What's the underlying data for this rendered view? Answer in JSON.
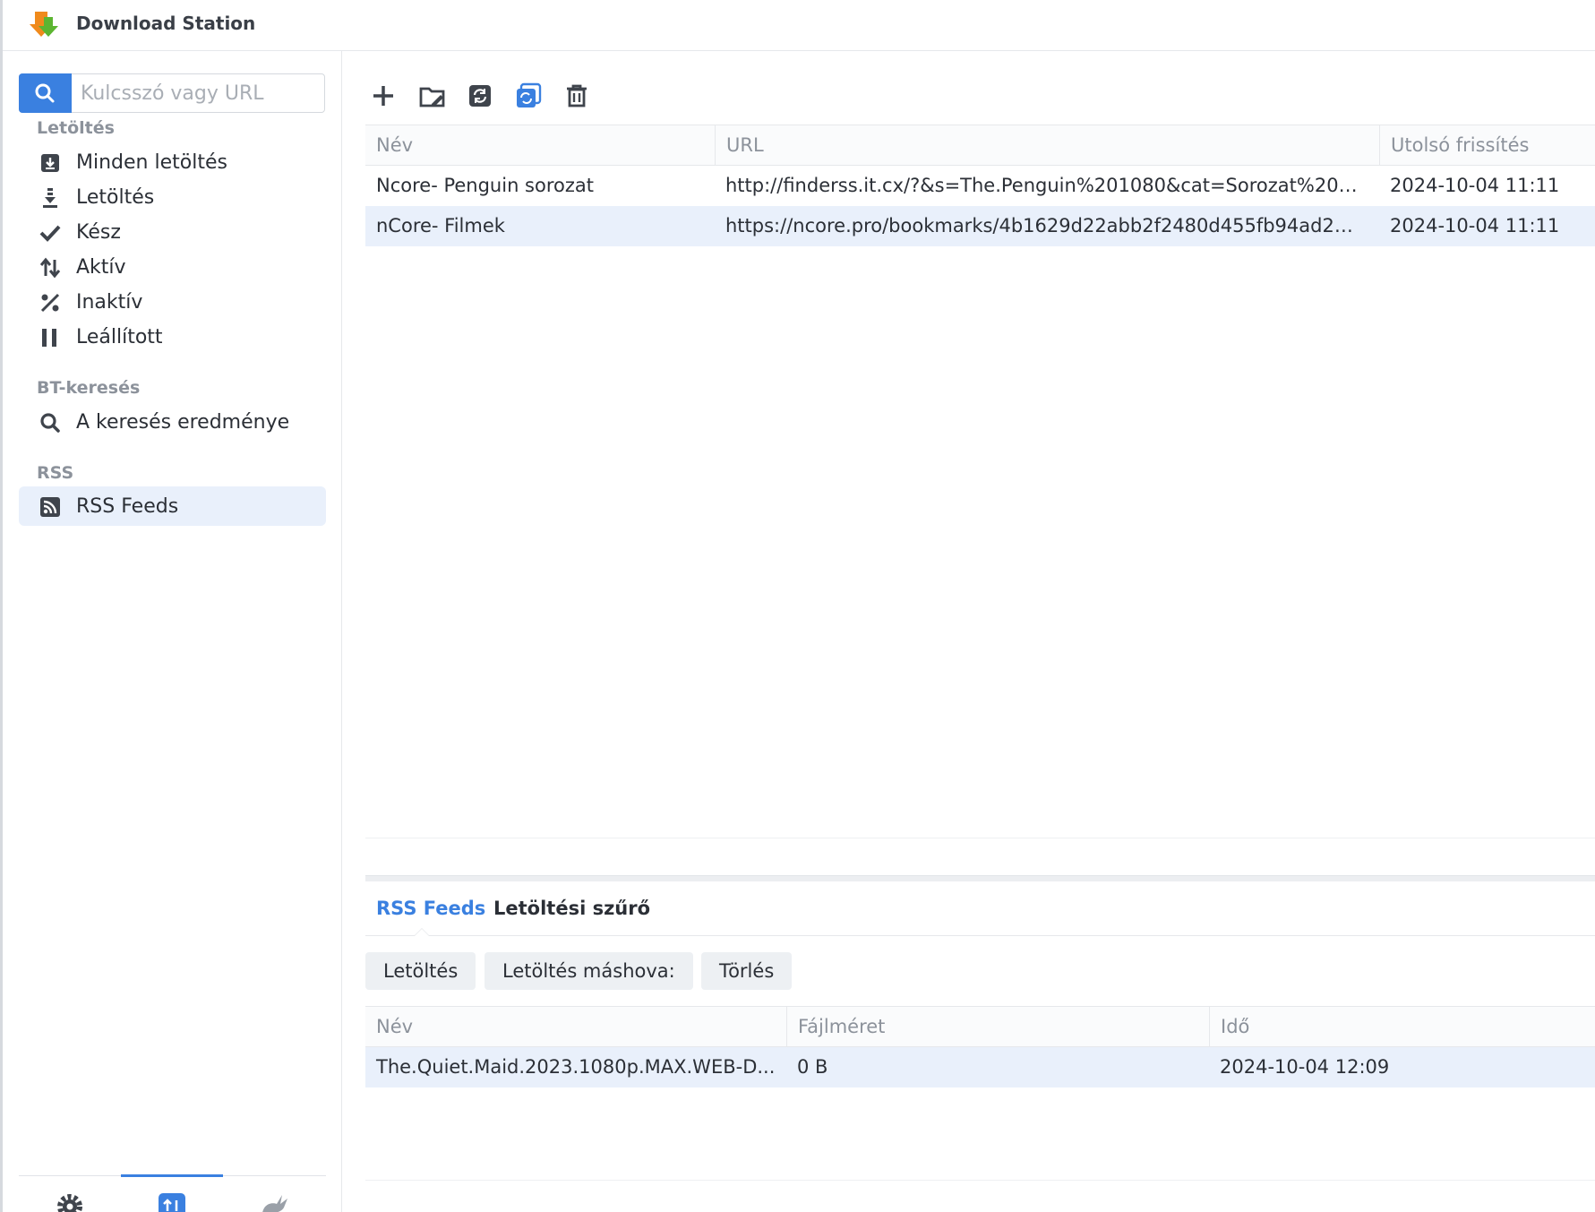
{
  "app": {
    "title": "Download Station"
  },
  "search": {
    "placeholder": "Kulcsszó vagy URL"
  },
  "sidebar": {
    "sections": [
      {
        "title": "Letöltés"
      },
      {
        "title": "BT-keresés"
      },
      {
        "title": "RSS"
      }
    ],
    "items": [
      {
        "label": "Minden letöltés",
        "icon": "download-box-icon"
      },
      {
        "label": "Letöltés",
        "icon": "download-arrow-icon"
      },
      {
        "label": "Kész",
        "icon": "check-icon"
      },
      {
        "label": "Aktív",
        "icon": "up-down-arrows-icon"
      },
      {
        "label": "Inaktív",
        "icon": "percent-icon"
      },
      {
        "label": "Leállított",
        "icon": "pause-icon"
      },
      {
        "label": "A keresés eredménye",
        "icon": "search-icon"
      },
      {
        "label": "RSS Feeds",
        "icon": "rss-icon",
        "active": true
      }
    ],
    "bottom_tabs": [
      {
        "icon": "gear-icon"
      },
      {
        "icon": "transfer-icon",
        "active": true
      },
      {
        "icon": "donkey-icon"
      }
    ]
  },
  "toolbar": {
    "buttons": [
      {
        "icon": "add-icon"
      },
      {
        "icon": "folder-edit-icon"
      },
      {
        "icon": "refresh-icon"
      },
      {
        "icon": "refresh-all-icon"
      },
      {
        "icon": "trash-icon"
      }
    ]
  },
  "feeds_table": {
    "columns": [
      "Név",
      "URL",
      "Utolsó frissítés"
    ],
    "rows": [
      {
        "name": "Ncore- Penguin sorozat",
        "url": "http://finderss.it.cx/?&s=The.Penguin%201080&cat=Sorozat%20(...",
        "updated": "2024-10-04 11:11"
      },
      {
        "name": "nCore- Filmek",
        "url": "https://ncore.pro/bookmarks/4b1629d22abb2f2480d455fb94ad22...",
        "updated": "2024-10-04 11:11",
        "selected": true
      }
    ]
  },
  "bottom_panel": {
    "tabs": [
      {
        "label": "RSS Feeds",
        "active": true
      },
      {
        "label": "Letöltési szűrő"
      }
    ],
    "actions": [
      "Letöltés",
      "Letöltés máshova:",
      "Törlés"
    ],
    "columns": [
      "Név",
      "Fájlméret",
      "Idő"
    ],
    "rows": [
      {
        "name": "The.Quiet.Maid.2023.1080p.MAX.WEB-D...",
        "size": "0 B",
        "time": "2024-10-04 12:09",
        "selected": true
      }
    ]
  },
  "colors": {
    "accent": "#3a80e0",
    "selected_row": "#e9f0fb",
    "logo_orange": "#f08a1c",
    "logo_green": "#5cb531"
  }
}
